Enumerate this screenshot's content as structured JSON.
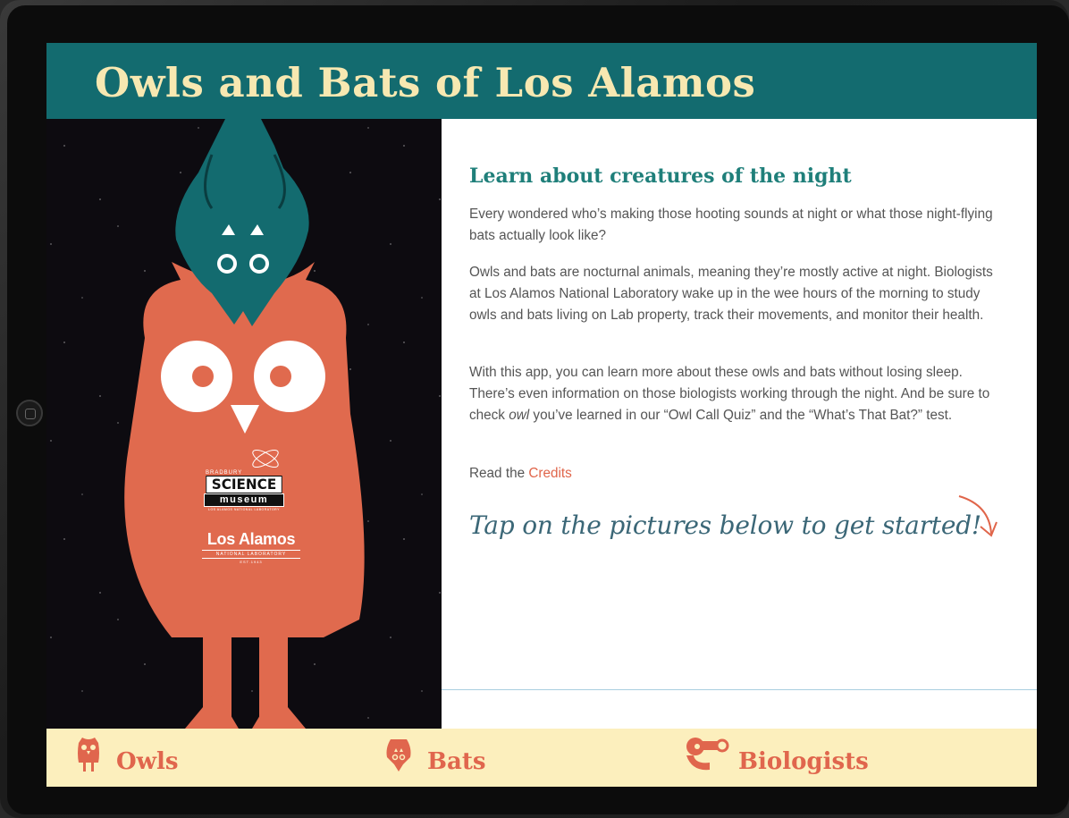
{
  "app": {
    "title": "Owls and Bats of Los Alamos"
  },
  "hero": {
    "museum_logo": {
      "top": "BRADBURY",
      "science": "SCIENCE",
      "museum": "museum",
      "bottom": "LOS ALAMOS NATIONAL LABORATORY"
    },
    "lab_logo": {
      "name": "Los Alamos",
      "sub": "NATIONAL LABORATORY",
      "est": "EST.1943"
    }
  },
  "content": {
    "heading": "Learn about creatures of the night",
    "p1": "Every wondered who’s making those hooting sounds at night or what those night-flying bats actually look like?",
    "p2": "Owls and bats are nocturnal animals, meaning they’re mostly active at night. Biologists at Los Alamos National Laboratory wake up in the wee hours of the morning to study owls and bats living on Lab property, track their movements, and monitor their health.",
    "p3_before": "With this app, you can learn more about these owls and bats without losing sleep. There’s even information on those biologists working through the night. And be sure to check ",
    "p3_em": "owl",
    "p3_after": " you’ve learned in our “Owl Call Quiz” and the “What’s That Bat?” test.",
    "credits_prefix": "Read the ",
    "credits_link": "Credits",
    "tap_prompt": "Tap on the pictures below to get started!"
  },
  "tabs": [
    {
      "label": "Owls",
      "icon": "owl-icon"
    },
    {
      "label": "Bats",
      "icon": "bat-icon"
    },
    {
      "label": "Biologists",
      "icon": "biologist-binoculars-icon"
    }
  ],
  "colors": {
    "header": "#136b6f",
    "title": "#f7e8b1",
    "owl": "#e06a4e",
    "bat": "#136b6f",
    "tabbar": "#fcefbd",
    "accent": "#e0654a",
    "heading": "#1f7f7a"
  }
}
